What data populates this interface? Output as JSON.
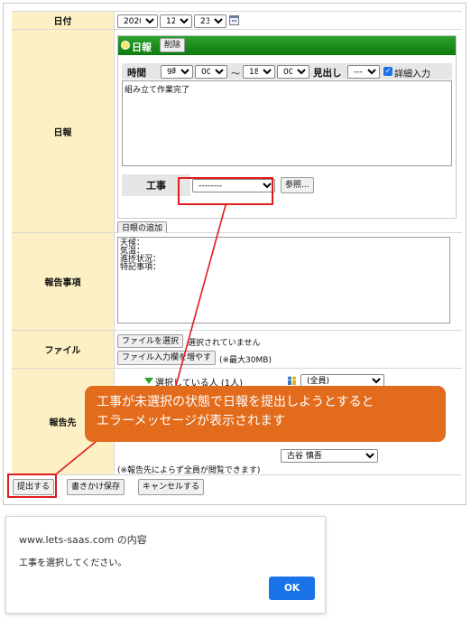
{
  "form": {
    "date": {
      "label": "日付",
      "year": "2020年",
      "month": "12月",
      "day": "23日"
    },
    "nippo": {
      "label": "日報",
      "box_title": "日報",
      "delete_label": "削除",
      "time_label": "時間",
      "start_hour": "9時",
      "start_min": "00分",
      "tilde": "〜",
      "end_hour": "18時",
      "end_min": "00分",
      "midashi_label": "見出し",
      "midashi_value": "----",
      "detail_label": "詳細入力",
      "body_text": "組み立て作業完了",
      "koji_label": "工事",
      "koji_value": "--------",
      "ref_label": "参照...",
      "add_label": "日眼の追加"
    },
    "report": {
      "label": "報告事項",
      "text": "天候：\n気温：\n進捗状況：\n特記事項："
    },
    "file": {
      "label": "ファイル",
      "choose_label": "ファイルを選択",
      "none_text": "選択されていません",
      "add_field_label": "ファイル入力欄を増やす",
      "max_note": "(※最大30MB)"
    },
    "recipients": {
      "label": "報告先",
      "selected_label": "選択している人 (1人)",
      "group_value": "(全員)",
      "person_value": "古谷 慎吾",
      "note": "(※報告先によらず全員が閲覧できます)"
    }
  },
  "actions": {
    "submit_label": "提出する",
    "draft_label": "書きかけ保存",
    "cancel_label": "キャンセルする"
  },
  "callout": {
    "line1": "工事が未選択の状態で日報を提出しようとすると",
    "line2": "エラーメッセージが表示されます"
  },
  "dialog": {
    "title": "www.lets-saas.com の内容",
    "message": "工事を選択してください。",
    "ok_label": "OK"
  },
  "colors": {
    "label_bg": "#fdf0c4",
    "header_green": "#1a8c1a",
    "highlight_red": "#e01b1b",
    "callout_orange": "#e36b1c",
    "ok_blue": "#1a73e8"
  }
}
